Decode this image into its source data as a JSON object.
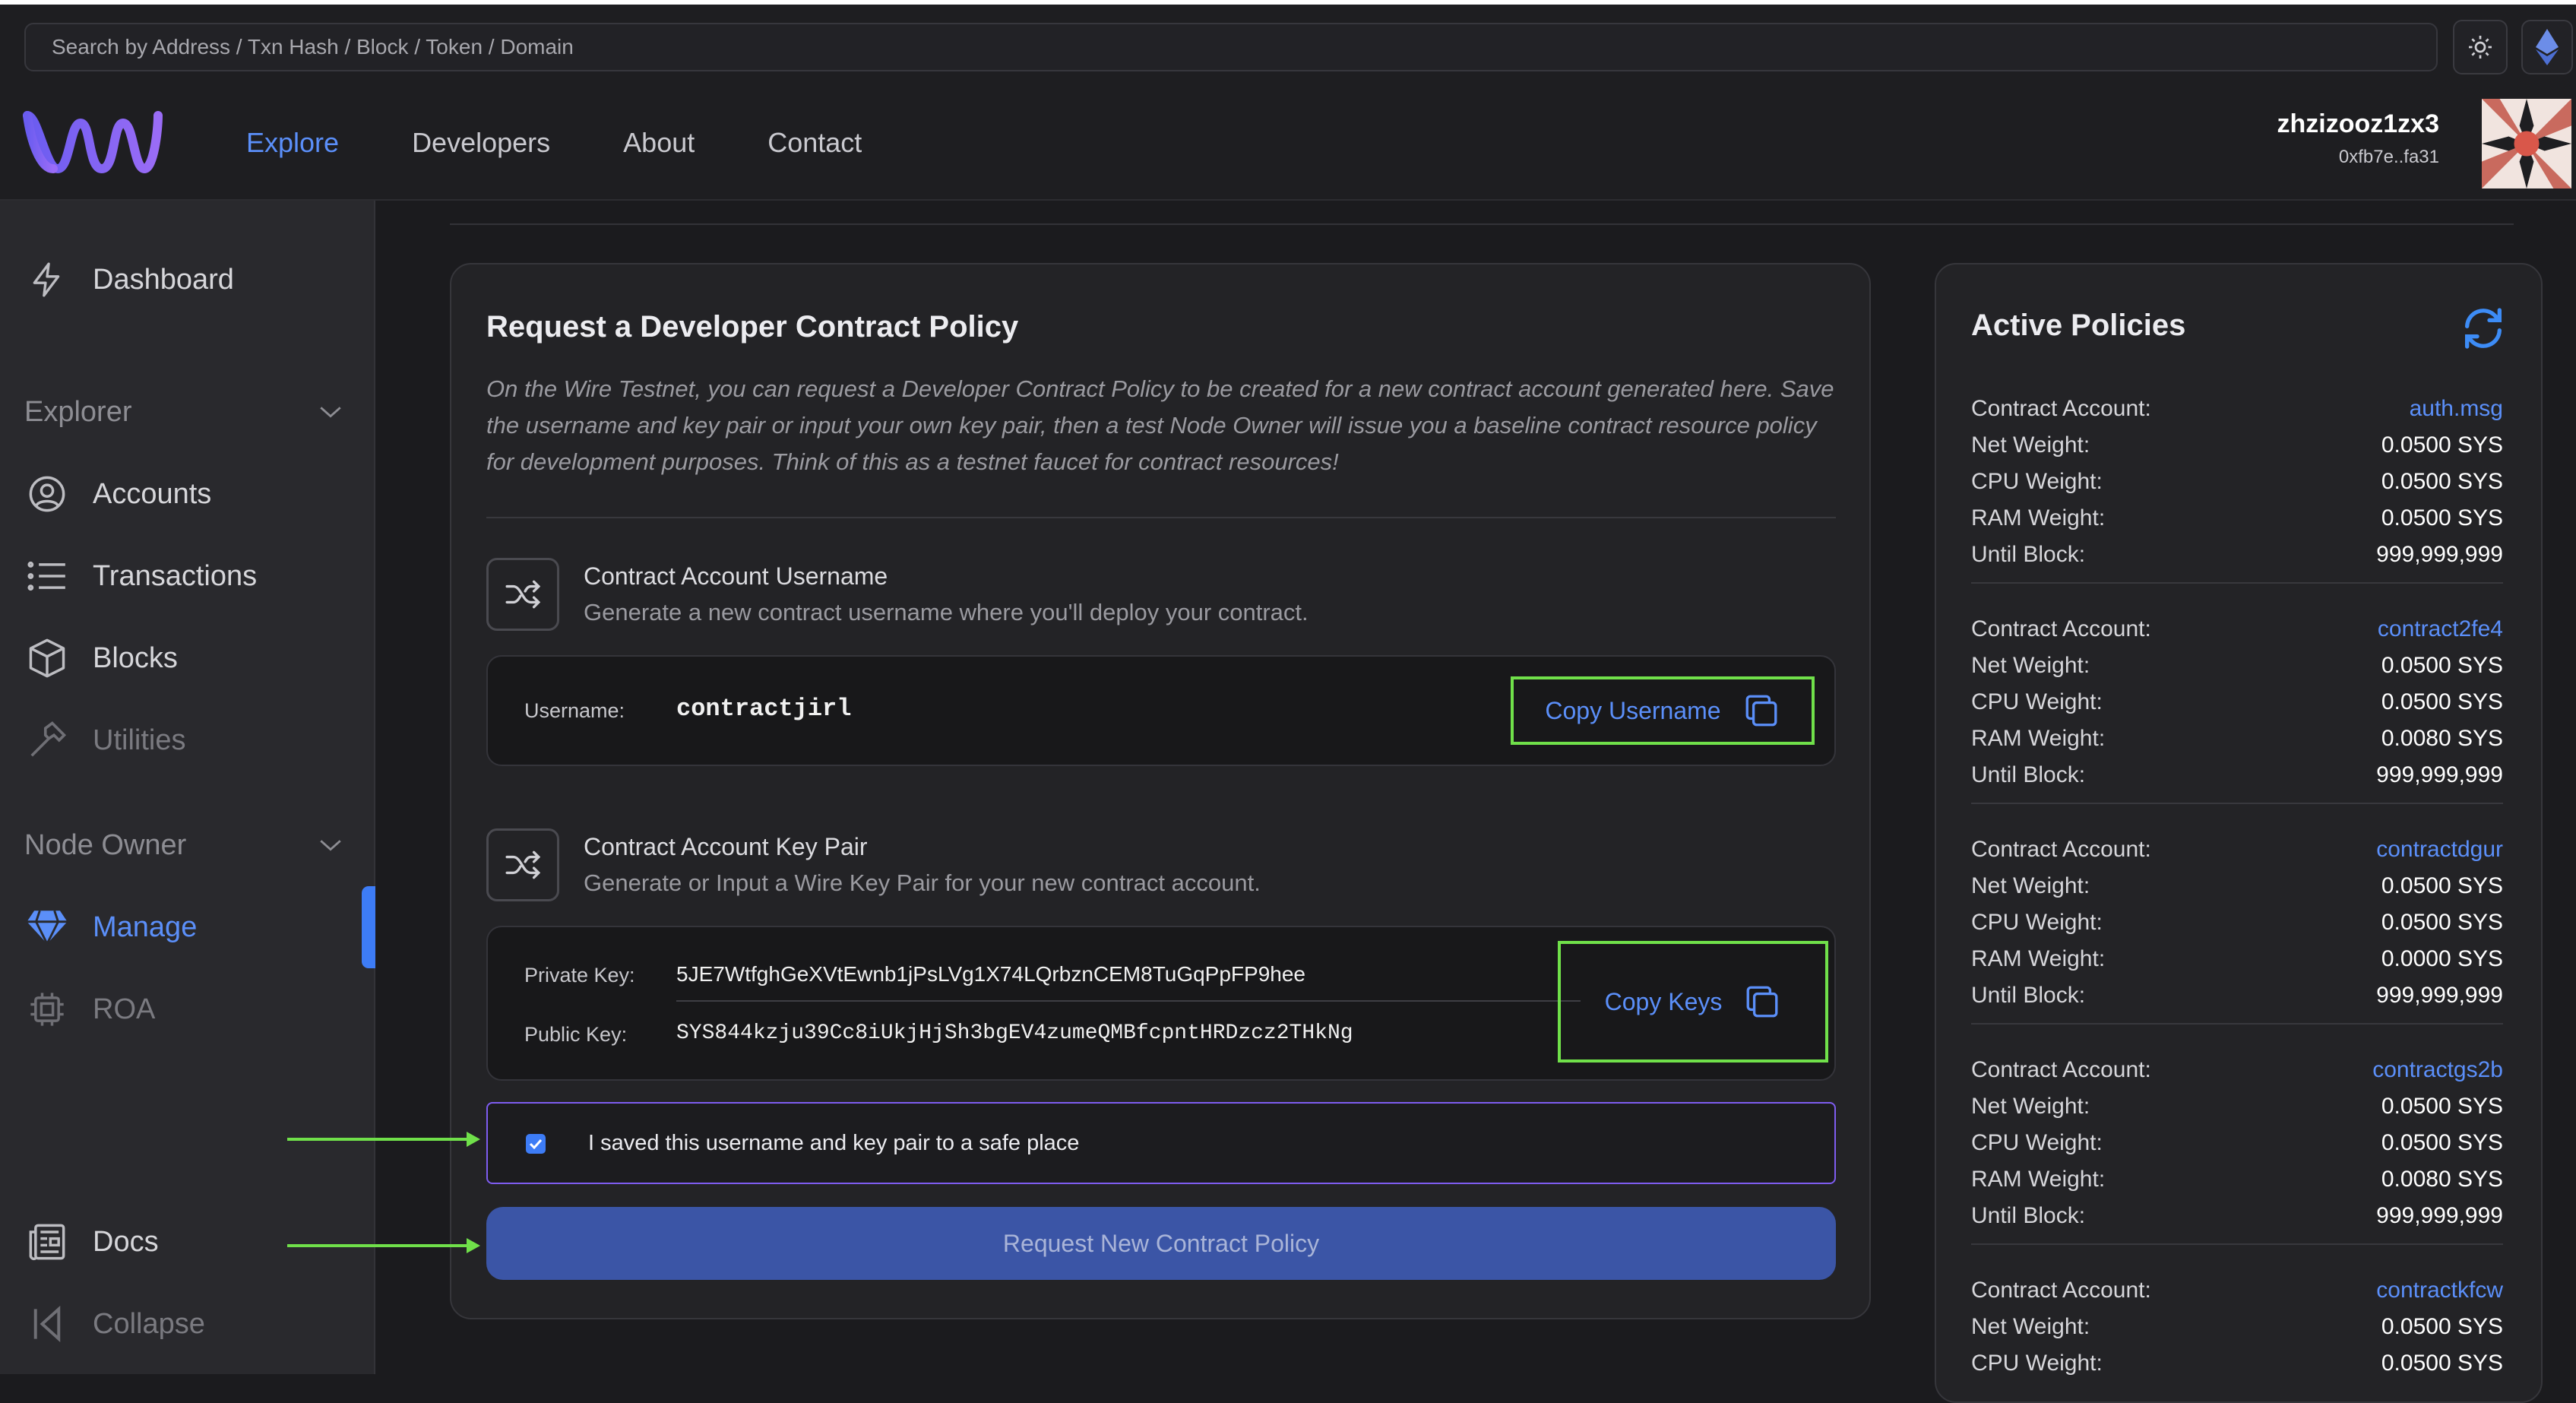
{
  "search": {
    "placeholder": "Search by Address / Txn Hash / Block / Token / Domain"
  },
  "nav": {
    "items": [
      "Explore",
      "Developers",
      "About",
      "Contact"
    ],
    "active": "Explore"
  },
  "user": {
    "name": "zhzizooz1zx3",
    "address": "0xfb7e..fa31"
  },
  "sidebar": {
    "dashboard": "Dashboard",
    "explorer_group": "Explorer",
    "accounts": "Accounts",
    "transactions": "Transactions",
    "blocks": "Blocks",
    "utilities": "Utilities",
    "node_owner_group": "Node Owner",
    "manage": "Manage",
    "roa": "ROA",
    "docs": "Docs",
    "collapse": "Collapse"
  },
  "request_card": {
    "title": "Request a Developer Contract Policy",
    "description": "On the Wire Testnet, you can request a Developer Contract Policy to be created for a new contract account generated here. Save the username and key pair or input your own key pair, then a test Node Owner will issue you a baseline contract resource policy for development purposes. Think of this as a testnet faucet for contract resources!",
    "username_section": {
      "title": "Contract Account Username",
      "subtitle": "Generate a new contract username where you'll deploy your contract.",
      "label": "Username:",
      "value": "contractjirl",
      "copy_label": "Copy Username"
    },
    "keypair_section": {
      "title": "Contract Account Key Pair",
      "subtitle": "Generate or Input a Wire Key Pair for your new contract account.",
      "private_label": "Private Key:",
      "private_value": "5JE7WtfghGeXVtEwnb1jPsLVg1X74LQrbznCEM8TuGqPpFP9hee",
      "public_label": "Public Key:",
      "public_value": "SYS844kzju39Cc8iUkjHjSh3bgEV4zumeQMBfcpntHRDzcz2THkNg",
      "copy_label": "Copy Keys"
    },
    "saved_checkbox": {
      "label": "I saved this username and key pair to a safe place",
      "checked": true
    },
    "request_button": "Request New Contract Policy"
  },
  "active_policies": {
    "title": "Active Policies",
    "row_labels": {
      "account": "Contract Account:",
      "net": "Net Weight:",
      "cpu": "CPU Weight:",
      "ram": "RAM Weight:",
      "until": "Until Block:"
    },
    "policies": [
      {
        "account": "auth.msg",
        "net": "0.0500 SYS",
        "cpu": "0.0500 SYS",
        "ram": "0.0500 SYS",
        "until": "999,999,999"
      },
      {
        "account": "contract2fe4",
        "net": "0.0500 SYS",
        "cpu": "0.0500 SYS",
        "ram": "0.0080 SYS",
        "until": "999,999,999"
      },
      {
        "account": "contractdgur",
        "net": "0.0500 SYS",
        "cpu": "0.0500 SYS",
        "ram": "0.0000 SYS",
        "until": "999,999,999"
      },
      {
        "account": "contractgs2b",
        "net": "0.0500 SYS",
        "cpu": "0.0500 SYS",
        "ram": "0.0080 SYS",
        "until": "999,999,999"
      },
      {
        "account": "contractkfcw",
        "net": "0.0500 SYS",
        "cpu": "0.0500 SYS"
      }
    ]
  },
  "colors": {
    "accent": "#5b8ff9",
    "highlight": "#70e04a",
    "checkbox_border": "#7e5cf0"
  }
}
